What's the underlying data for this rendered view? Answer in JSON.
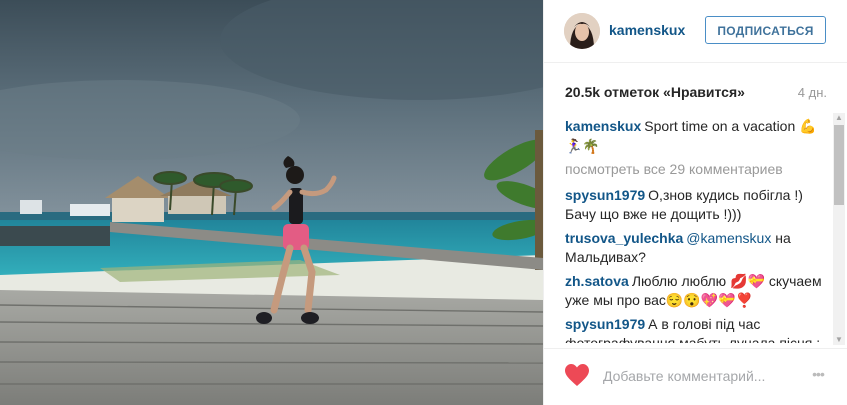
{
  "post": {
    "username": "kamenskux",
    "follow_label": "ПОДПИСАТЬСЯ",
    "likes_text": "20.5k отметок «Нравится»",
    "time_ago": "4 дн.",
    "photo_icon": "photo-image"
  },
  "caption": {
    "author": "kamenskux",
    "text": "Sport time on a vacation 💪🏃‍♀️🌴"
  },
  "view_all": "посмотреть все 29 комментариев",
  "comments": [
    {
      "author": "spysun1979",
      "text": "О,знов кудись побігла !) Бачу що вже не дощить !)))"
    },
    {
      "author": "trusova_yulechka",
      "mention": "@kamenskux",
      "text": " на Мальдивах?"
    },
    {
      "author": "zh.satova",
      "text": "Люблю люблю 💋💝 скучаем уже мы про вас😌😯💖💝❣️"
    },
    {
      "author": "spysun1979",
      "text": "А в голові під час фотографування,мабуть лунала пісня : \"Отриваясь от земли\")))"
    }
  ],
  "footer": {
    "placeholder": "Добавьте комментарий...",
    "more_label": "•••",
    "like_icon": "heart-icon",
    "like_color": "#ed4956"
  },
  "colors": {
    "link": "#125688",
    "follow_border": "#4a8ec6",
    "muted": "#999999"
  }
}
